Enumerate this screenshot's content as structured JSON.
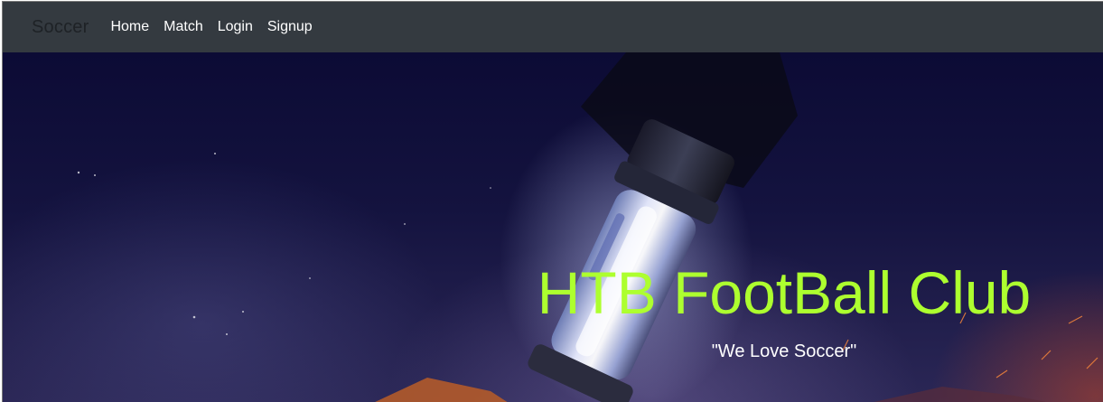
{
  "navbar": {
    "brand": "Soccer",
    "links": [
      "Home",
      "Match",
      "Login",
      "Signup"
    ]
  },
  "hero": {
    "title": "HTB FootBall Club",
    "subtitle": "\"We Love Soccer\""
  },
  "colors": {
    "navbar_bg": "#343a40",
    "title": "#adff2f",
    "hero_dark": "#0c0b35"
  }
}
